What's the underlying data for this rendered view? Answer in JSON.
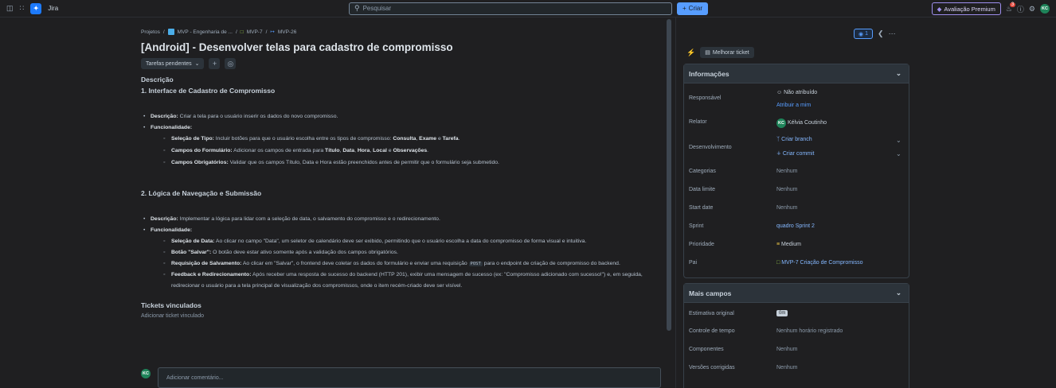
{
  "topbar": {
    "brand": "Jira",
    "search_placeholder": "Pesquisar",
    "create_label": "Criar",
    "premium_label": "Avaliação Premium",
    "notifications_count": "3",
    "user_initials": "KC"
  },
  "breadcrumb": {
    "projects": "Projetos",
    "project": "MVP - Engenharia de ...",
    "epic": "MVP-7",
    "issue": "MVP-26",
    "sep": "/"
  },
  "issue": {
    "title": "[Android] - Desenvolver telas para cadastro de compromisso",
    "status": "Tarefas pendentes"
  },
  "description": {
    "label": "Descrição",
    "section1": {
      "heading": "1. Interface de Cadastro de Compromisso",
      "desc_label": "Descrição:",
      "desc_text": " Criar a tela para o usuário inserir os dados do novo compromisso.",
      "func_label": "Funcionalidade:",
      "items": [
        {
          "label": "Seleção de Tipo:",
          "text": " Incluir botões para que o usuário escolha entre os tipos de compromisso: ",
          "b1": "Consulta",
          "t2": ", ",
          "b2": "Exame",
          "t3": " e ",
          "b3": "Tarefa",
          "t4": "."
        },
        {
          "label": "Campos do Formulário:",
          "text": " Adicionar os campos de entrada para ",
          "b1": "Título",
          "t2": ", ",
          "b2": "Data",
          "t3": ", ",
          "b3": "Hora",
          "t4": ", ",
          "b4": "Local",
          "t5": " e ",
          "b5": "Observações",
          "t6": "."
        },
        {
          "label": "Campos Obrigatórios:",
          "text": " Validar que os campos Título, Data e Hora estão preenchidos antes de permitir que o formulário seja submetido."
        }
      ]
    },
    "section2": {
      "heading": "2. Lógica de Navegação e Submissão",
      "desc_label": "Descrição:",
      "desc_text": " Implementar a lógica para lidar com a seleção de data, o salvamento do compromisso e o redirecionamento.",
      "func_label": "Funcionalidade:",
      "items": [
        {
          "label": "Seleção de Data:",
          "text": " Ao clicar no campo \"Data\", um seletor de calendário deve ser exibido, permitindo que o usuário escolha a data do compromisso de forma visual e intuitiva."
        },
        {
          "label": "Botão \"Salvar\":",
          "text": " O botão deve estar ativo somente após a validação dos campos obrigatórios."
        },
        {
          "label": "Requisição de Salvamento:",
          "text": " Ao clicar em \"Salvar\", o frontend deve coletar os dados do formulário e enviar uma requisição ",
          "code": "POST",
          "text2": " para o endpoint de criação de compromisso do backend."
        },
        {
          "label": "Feedback e Redirecionamento:",
          "text": " Após receber uma resposta de sucesso do backend (HTTP 201), exibir uma mensagem de sucesso (ex: \"Compromisso adicionado com sucesso!\") e, em seguida, redirecionar o usuário para a tela principal de visualização dos compromissos, onde o item recém-criado deve ser visível."
        }
      ]
    }
  },
  "linked": {
    "title": "Tickets vinculados",
    "add": "Adicionar ticket vinculado"
  },
  "comment": {
    "placeholder": "Adicionar comentário...",
    "avatar": "KC"
  },
  "sidebar": {
    "watch_count": "1",
    "improve_label": "Melhorar ticket",
    "info": {
      "heading": "Informações",
      "fields": {
        "assignee_label": "Responsável",
        "assignee_value": "Não atribuído",
        "assign_me": "Atribuir a mim",
        "reporter_label": "Relator",
        "reporter_value": "Kélvia Coutinho",
        "reporter_initials": "KC",
        "dev_label": "Desenvolvimento",
        "dev_branch": "Criar branch",
        "dev_commit": "Criar commit",
        "categories_label": "Categorias",
        "categories_value": "Nenhum",
        "due_label": "Data limite",
        "due_value": "Nenhum",
        "start_label": "Start date",
        "start_value": "Nenhum",
        "sprint_label": "Sprint",
        "sprint_value": "quadro Sprint 2",
        "priority_label": "Prioridade",
        "priority_value": "Medium",
        "parent_label": "Pai",
        "parent_value": "MVP-7 Criação de Compromisso"
      }
    },
    "more": {
      "heading": "Mais campos",
      "fields": {
        "estimate_label": "Estimativa original",
        "estimate_value": "0m",
        "time_label": "Controle de tempo",
        "time_value": "Nenhum horário registrado",
        "components_label": "Componentes",
        "components_value": "Nenhum",
        "versions_label": "Versões corrigidas",
        "versions_value": "Nenhum"
      }
    }
  },
  "colors": {
    "accent": "#579dff",
    "premium": "#9f8fef",
    "avatar": "#1f845a",
    "priority": "#f5cd47"
  }
}
